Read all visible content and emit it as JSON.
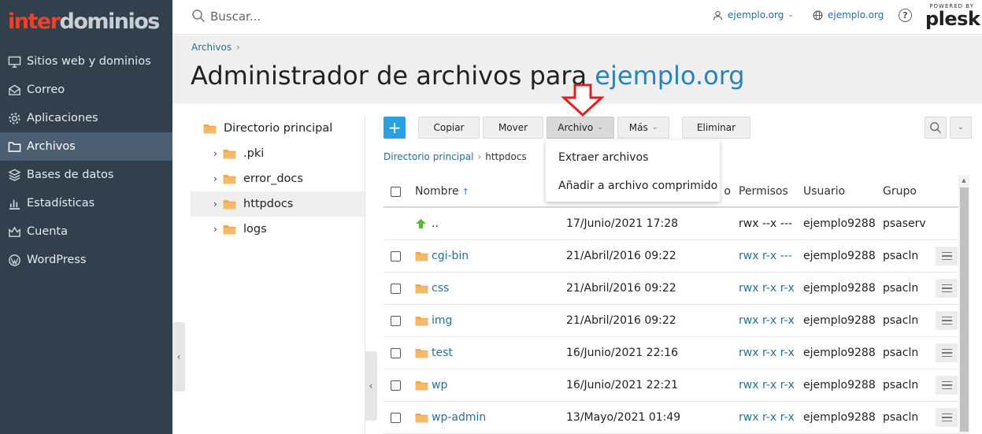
{
  "brand": {
    "logo_part1": "inter",
    "logo_part2": "dominios"
  },
  "sidebar": {
    "items": [
      {
        "label": "Sitios web y dominios",
        "icon": "monitor-icon"
      },
      {
        "label": "Correo",
        "icon": "mail-icon"
      },
      {
        "label": "Aplicaciones",
        "icon": "gear-icon"
      },
      {
        "label": "Archivos",
        "icon": "folder-icon",
        "active": true
      },
      {
        "label": "Bases de datos",
        "icon": "database-icon"
      },
      {
        "label": "Estadísticas",
        "icon": "bar-chart-icon"
      },
      {
        "label": "Cuenta",
        "icon": "account-icon"
      },
      {
        "label": "WordPress",
        "icon": "wordpress-icon"
      }
    ]
  },
  "header": {
    "search_placeholder": "Buscar...",
    "user_label": "ejemplo.org",
    "domain_label": "ejemplo.org",
    "help_label": "?",
    "powered_by": "POWERED BY",
    "plesk_label": "plesk"
  },
  "title_area": {
    "breadcrumb": "Archivos",
    "title_prefix": "Administrador de archivos para ",
    "title_domain": "ejemplo.org"
  },
  "tree": {
    "root": "Directorio principal",
    "children": [
      ".pki",
      "error_docs",
      "httpdocs",
      "logs"
    ],
    "selected": "httpdocs"
  },
  "toolbar": {
    "add_label": "+",
    "copy_label": "Copiar",
    "move_label": "Mover",
    "archive_label": "Archivo",
    "more_label": "Más",
    "delete_label": "Eliminar"
  },
  "archive_menu": {
    "items": [
      "Extraer archivos",
      "Añadir a archivo comprimido"
    ]
  },
  "path": {
    "root": "Directorio principal",
    "current": "httpdocs"
  },
  "table": {
    "columns": {
      "name": "Nombre",
      "date": "o",
      "perms": "Permisos",
      "user": "Usuario",
      "group": "Grupo"
    },
    "sort_indicator": "↑",
    "rows": [
      {
        "name": "..",
        "date": "17/Junio/2021 17:28",
        "perms": "rwx --x ---",
        "user": "ejemplo9288",
        "group": "psaserv",
        "type": "parent"
      },
      {
        "name": "cgi-bin",
        "date": "21/Abril/2016 09:22",
        "perms": "rwx r-x ---",
        "user": "ejemplo9288",
        "group": "psacln",
        "type": "folder"
      },
      {
        "name": "css",
        "date": "21/Abril/2016 09:22",
        "perms": "rwx r-x r-x",
        "user": "ejemplo9288",
        "group": "psacln",
        "type": "folder"
      },
      {
        "name": "img",
        "date": "21/Abril/2016 09:22",
        "perms": "rwx r-x r-x",
        "user": "ejemplo9288",
        "group": "psacln",
        "type": "folder"
      },
      {
        "name": "test",
        "date": "16/Junio/2021 22:16",
        "perms": "rwx r-x r-x",
        "user": "ejemplo9288",
        "group": "psacln",
        "type": "folder"
      },
      {
        "name": "wp",
        "date": "16/Junio/2021 22:21",
        "perms": "rwx r-x r-x",
        "user": "ejemplo9288",
        "group": "psacln",
        "type": "folder"
      },
      {
        "name": "wp-admin",
        "date": "13/Mayo/2021 01:49",
        "perms": "rwx r-x r-x",
        "user": "ejemplo9288",
        "group": "psacln",
        "type": "folder"
      }
    ]
  },
  "colors": {
    "sidebar_bg": "#32404e",
    "sidebar_active": "#4b5e72",
    "logo_red": "#e8442d",
    "link_blue": "#2a6f94",
    "title_domain_blue": "#2a83b8",
    "folder_orange": "#f0a852",
    "add_button_blue": "#2aa0e0",
    "annotation_arrow": "#e02020"
  }
}
